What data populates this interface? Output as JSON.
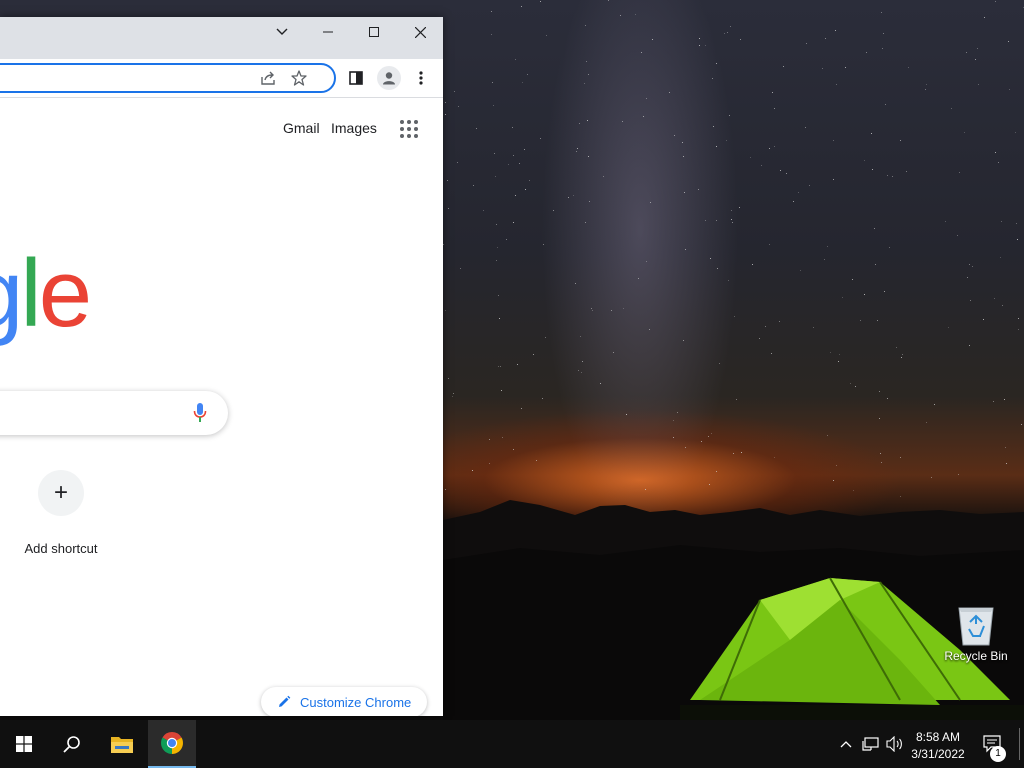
{
  "browser": {
    "header_links": {
      "gmail": "Gmail",
      "images": "Images"
    },
    "logo_partial": [
      "g",
      "l",
      "e"
    ],
    "logo_colors": [
      "#4285f4",
      "#34a853",
      "#ea4335"
    ],
    "shortcut": {
      "plus": "+",
      "label": "Add shortcut"
    },
    "customize_label": "Customize Chrome",
    "accent_color": "#1a73e8"
  },
  "desktop": {
    "recycle_bin_label": "Recycle Bin"
  },
  "taskbar": {
    "time": "8:58 AM",
    "date": "3/31/2022",
    "notification_count": "1"
  }
}
